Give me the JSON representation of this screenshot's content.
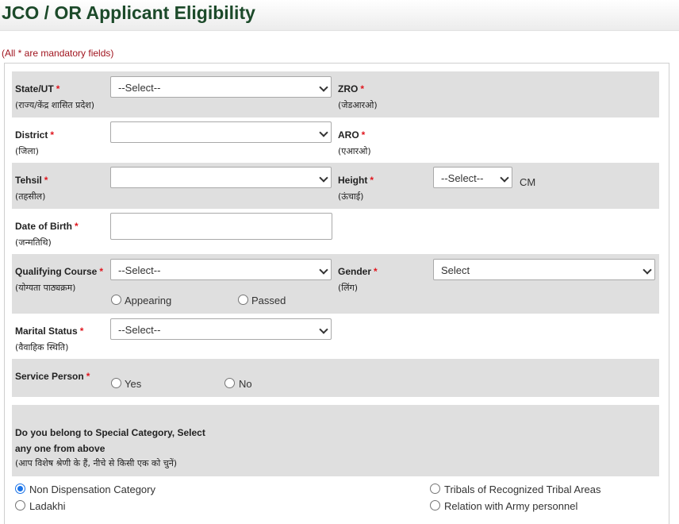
{
  "page": {
    "title": "JCO / OR Applicant Eligibility",
    "mandatory_note": "(All * are mandatory fields)"
  },
  "form": {
    "state": {
      "label": "State/UT",
      "hindi": "(राज्य/केंद्र शासित प्रदेश)",
      "value": "--Select--"
    },
    "zro": {
      "label": "ZRO",
      "hindi": "(जेडआरओ)"
    },
    "district": {
      "label": "District",
      "hindi": "(जिला)",
      "value": ""
    },
    "aro": {
      "label": "ARO",
      "hindi": "(एआरओ)"
    },
    "tehsil": {
      "label": "Tehsil",
      "hindi": "(तहसील)",
      "value": ""
    },
    "height": {
      "label": "Height",
      "hindi": "(ऊंचाई)",
      "value": "--Select--",
      "unit": "CM"
    },
    "dob": {
      "label": "Date of Birth",
      "hindi": "(जन्मतिथि)",
      "value": ""
    },
    "qualifying_course": {
      "label": "Qualifying Course",
      "hindi": "(योग्यता पाठ्यक्रम)",
      "value": "--Select--",
      "options": [
        "Appearing",
        "Passed"
      ]
    },
    "gender": {
      "label": "Gender",
      "hindi": "(लिंग)",
      "value": "Select"
    },
    "marital_status": {
      "label": "Marital Status",
      "hindi": "(वैवाहिक स्थिति)",
      "value": "--Select--"
    },
    "service_person": {
      "label": "Service Person",
      "options": [
        "Yes",
        "No"
      ]
    },
    "special_category": {
      "question_line1": "Do you belong to Special Category, Select",
      "question_line2": "any one from above",
      "hindi": "(आप विशेष श्रेणी के हैं, नीचे से किसी एक को चुनें)",
      "options": [
        "Non Dispensation Category",
        "Tribals of Recognized Tribal Areas",
        "Ladakhi",
        "Relation with Army personnel"
      ],
      "selected": "Non Dispensation Category"
    }
  }
}
